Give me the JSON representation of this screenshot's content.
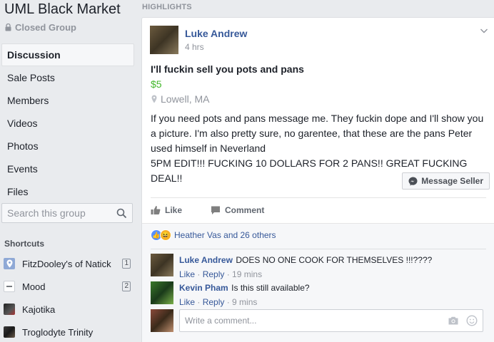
{
  "group": {
    "name": "UML Black Market",
    "privacy": "Closed Group"
  },
  "nav": [
    {
      "label": "Discussion",
      "active": true
    },
    {
      "label": "Sale Posts"
    },
    {
      "label": "Members"
    },
    {
      "label": "Videos"
    },
    {
      "label": "Photos"
    },
    {
      "label": "Events"
    },
    {
      "label": "Files"
    }
  ],
  "search": {
    "placeholder": "Search this group"
  },
  "shortcuts": {
    "heading": "Shortcuts",
    "items": [
      {
        "label": "FitzDooley's of Natick",
        "count": "1",
        "icon": "location-pin-icon"
      },
      {
        "label": "Mood",
        "count": "2",
        "icon": "mood-icon"
      },
      {
        "label": "Kajotika",
        "icon": "group-photo-icon"
      },
      {
        "label": "Troglodyte Trinity",
        "icon": "group-photo-icon"
      }
    ]
  },
  "main": {
    "section_label": "HIGHLIGHTS"
  },
  "post": {
    "author": "Luke Andrew",
    "time": "4 hrs",
    "title": "I'll fuckin sell you pots and pans",
    "price": "$5",
    "location": "Lowell, MA",
    "body_lines": [
      "If you need pots and pans message me. They fuckin dope and I'll show you",
      "a picture. I'm also pretty sure, no garentee, that these are the pans Peter",
      "used himself in Neverland",
      "5PM EDIT!!! FUCKING 10 DOLLARS FOR 2 PANS!! GREAT FUCKING DEAL!!"
    ],
    "message_button": "Message Seller",
    "actions": {
      "like": "Like",
      "comment": "Comment"
    },
    "reactions_text": "Heather Vas and 26 others",
    "comments": [
      {
        "author": "Luke Andrew",
        "text": "DOES NO ONE COOK FOR THEMSELVES !!!????",
        "like": "Like",
        "reply": "Reply",
        "time": "19 mins"
      },
      {
        "author": "Kevin Pham",
        "text": "Is this still available?",
        "like": "Like",
        "reply": "Reply",
        "time": "9 mins"
      }
    ],
    "write_placeholder": "Write a comment..."
  },
  "colors": {
    "link": "#365899",
    "price": "#42b72a",
    "muted": "#90949c"
  }
}
